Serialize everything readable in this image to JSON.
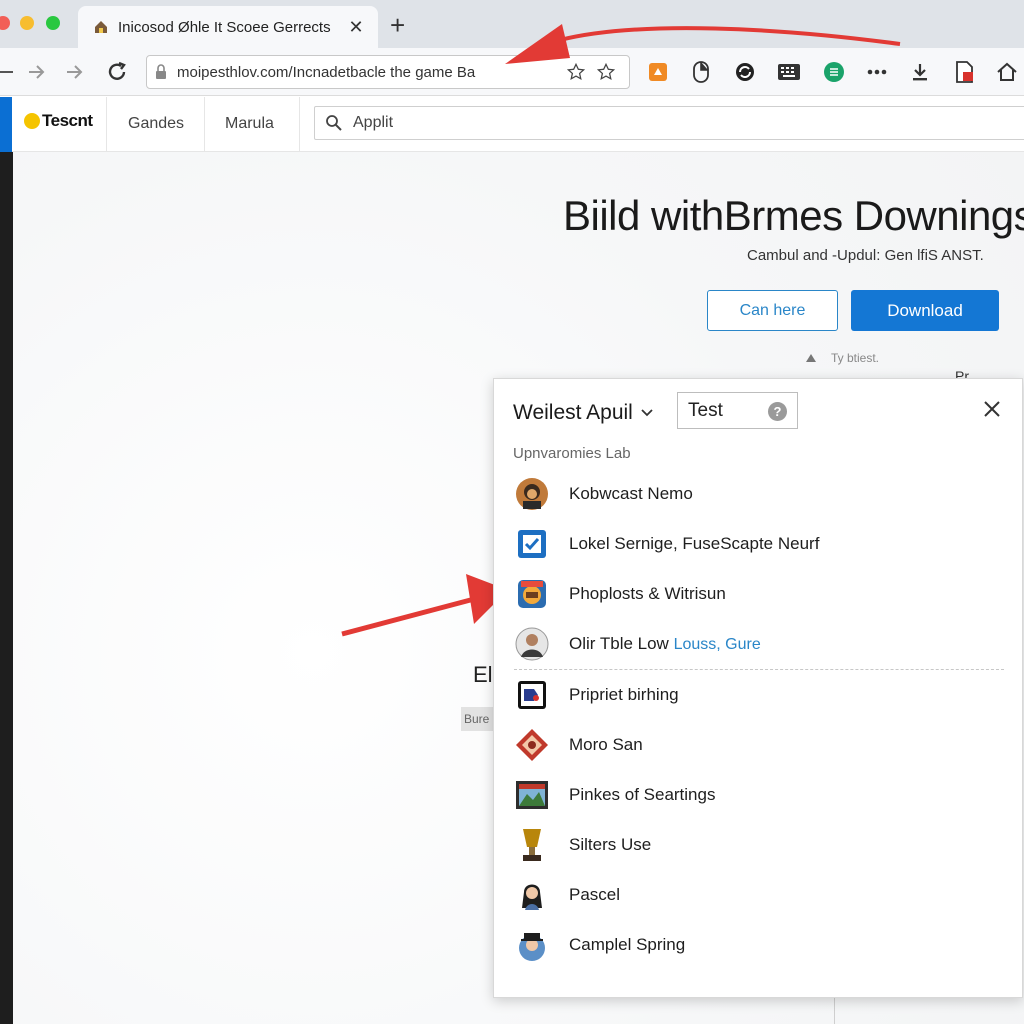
{
  "browser": {
    "tab_title": "Inicosod Øhle It Scoee Gerrects",
    "url": "moipesthlov.com/Incnadetbacle the game Ba"
  },
  "site": {
    "logo_text": "Tescnt",
    "nav": [
      "Gandes",
      "Marula"
    ],
    "search_value": "Applit"
  },
  "hero": {
    "title": "Biild withBrmes Downings",
    "subtitle": "Cambul and -Updul: Gen lfiS ANST.",
    "secondary_button": "Can here",
    "primary_button": "Download",
    "note": "Ty btiest.",
    "note_right": "Pr..."
  },
  "background_fragments": {
    "heading": "El",
    "badge": "Bure"
  },
  "panel": {
    "title": "Weilest Apuil",
    "select_value": "Test",
    "section_label": "Upnvaromies Lab",
    "items": [
      {
        "label": "Kobwcast Nemo",
        "icon": "game-portrait-icon"
      },
      {
        "label": "Lokel Sernige, FuseScapte Neurf",
        "icon": "checkbox-app-icon"
      },
      {
        "label": "Phoplosts & Witrisun",
        "icon": "badge-game-icon"
      },
      {
        "label": "Olir Tble Low",
        "link": "Louss, Gure",
        "icon": "person-avatar-icon"
      },
      {
        "label": "Pripriet birhing",
        "icon": "flag-app-icon"
      },
      {
        "label": "Moro San",
        "icon": "diamond-game-icon"
      },
      {
        "label": "Pinkes of Seartings",
        "icon": "landscape-game-icon"
      },
      {
        "label": "Silters Use",
        "icon": "trophy-icon"
      },
      {
        "label": "Pascel",
        "icon": "character-avatar-icon"
      },
      {
        "label": "Camplel Spring",
        "icon": "hat-character-icon"
      }
    ]
  },
  "colors": {
    "accent": "#1477d4",
    "annotation_arrow": "#e23a35"
  }
}
